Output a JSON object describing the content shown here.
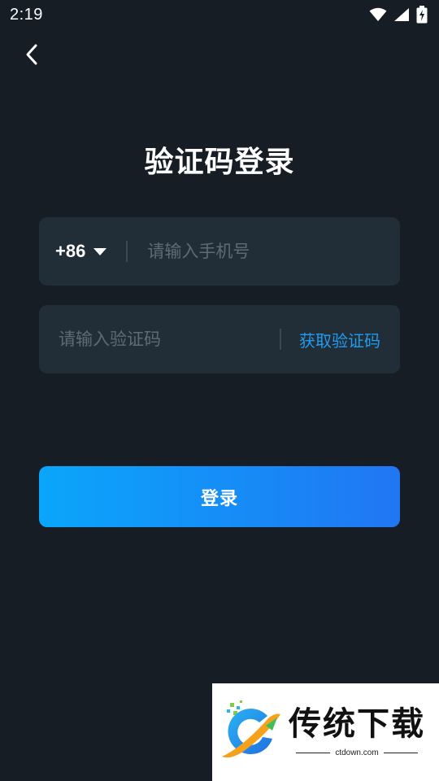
{
  "status_bar": {
    "time": "2:19",
    "icons": [
      "wifi-icon",
      "signal-icon",
      "battery-charging-icon"
    ]
  },
  "nav": {
    "back_icon": "chevron-left-icon"
  },
  "title": "验证码登录",
  "phone": {
    "country_code": "+86",
    "placeholder": "请输入手机号",
    "value": ""
  },
  "code": {
    "placeholder": "请输入验证码",
    "value": "",
    "get_code_label": "获取验证码"
  },
  "login_label": "登录",
  "watermark": {
    "name": "传统下载",
    "url": "ctdown.com"
  },
  "colors": {
    "background": "#161d24",
    "field": "#222e37",
    "accent": "#1f9bf0",
    "button_start": "#0aa6fb",
    "button_end": "#2176f3"
  }
}
